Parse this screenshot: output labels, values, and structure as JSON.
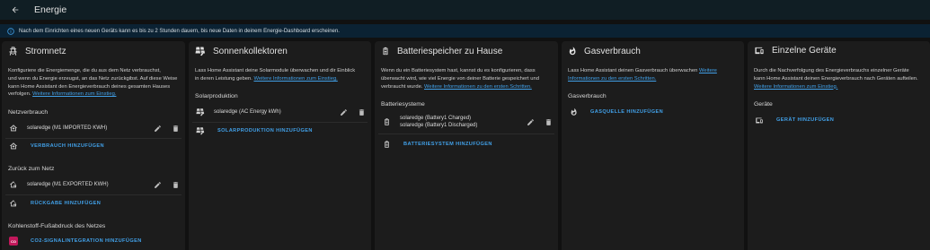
{
  "header": {
    "title": "Energie"
  },
  "banner": {
    "text": "Nach dem Einrichten eines neuen Geräts kann es bis zu 2 Stunden dauern, bis neue Daten in deinem Energie-Dashboard erscheinen."
  },
  "grid": {
    "title": "Stromnetz",
    "desc_lines": [
      "Konfiguriere die Energiemenge, die du aus dem Netz verbrauchst,",
      "und wenn du Energie erzeugst, an das Netz zurückgibst. Auf diese Weise",
      "kann Home Assistant den Energieverbrauch deines gesamten Hauses",
      "verfolgen."
    ],
    "desc_link": "Weitere Informationen zum Einstieg.",
    "consumption_label": "Netzverbrauch",
    "consumption_entity": "solaredge (M1 IMPORTED KWH)",
    "add_consumption": "VERBRAUCH HINZUFÜGEN",
    "return_label": "Zurück zum Netz",
    "return_entity": "solaredge (M1 EXPORTED KWH)",
    "add_return": "RÜCKGABE HINZUFÜGEN",
    "co2_label": "Kohlenstoff-Fußabdruck des Netzes",
    "add_co2": "CO2-SIGNALINTEGRATION HINZUFÜGEN"
  },
  "solar": {
    "title": "Sonnenkollektoren",
    "desc_lines": [
      "Lass Home Assistant deine Solarmodule überwachen und dir Einblick",
      "in deren Leistung geben."
    ],
    "desc_link": "Weitere Informationen zum Einstieg.",
    "section_label": "Solarproduktion",
    "entity": "solaredge (AC Energy kWh)",
    "add": "SOLARPRODUKTION HINZUFÜGEN"
  },
  "battery": {
    "title": "Batteriespeicher zu Hause",
    "desc_lines": [
      "Wenn du ein Batteriesystem hast, kannst du es konfigurieren, dass",
      "überwacht wird, wie viel Energie von deiner Batterie gespeichert und",
      "verbraucht wurde."
    ],
    "desc_link": "Weitere Informationen zu den ersten Schritten.",
    "section_label": "Batteriesysteme",
    "entity_line1": "solaredge (Battery1 Charged)",
    "entity_line2": "solaredge (Battery1 Discharged)",
    "add": "BATTERIESYSTEM HINZUFÜGEN"
  },
  "gas": {
    "title": "Gasverbrauch",
    "desc_lines": [
      "Lass Home Assistant deinen Gasverbrauch überwachen"
    ],
    "desc_link_a": "Weitere",
    "desc_link_b": "Informationen zu den ersten Schritten.",
    "section_label": "Gasverbrauch",
    "add": "GASQUELLE HINZUFÜGEN"
  },
  "devices": {
    "title": "Einzelne Geräte",
    "desc_lines": [
      "Durch die Nachverfolgung des Energieverbrauchs einzelner Geräte",
      "kann Home Assistant deinen Energieverbrauch nach Geräten aufteilen."
    ],
    "desc_link": "Weitere Informationen zum Einstieg.",
    "section_label": "Geräte",
    "add": "GERÄT HINZUFÜGEN"
  },
  "colors": {
    "accent": "#41a0e8",
    "card": "#1c1c1c",
    "background": "#111111",
    "topbar": "#101e24",
    "banner": "#0b2233",
    "co2": "#c2185b"
  }
}
